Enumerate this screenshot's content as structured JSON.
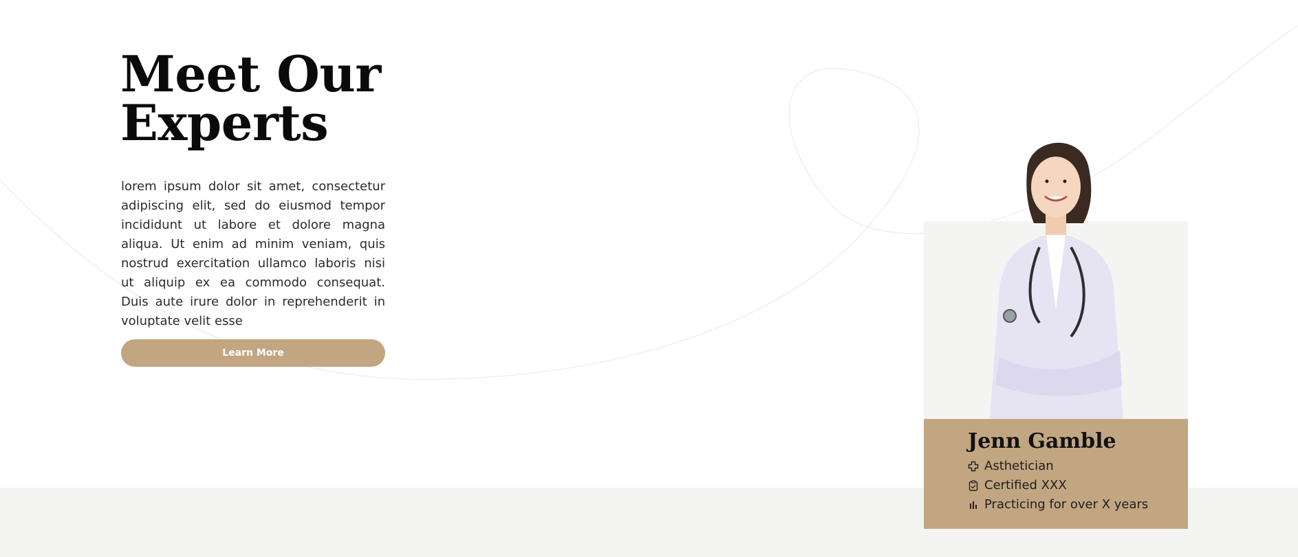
{
  "hero": {
    "heading_line1": "Meet Our",
    "heading_line2": "Experts",
    "body": "lorem ipsum dolor sit amet, consectetur adipiscing elit, sed do eiusmod tempor incididunt ut labore et dolore magna aliqua. Ut enim ad minim veniam, quis nostrud exercitation ullamco laboris nisi ut aliquip ex ea commodo consequat. Duis aute irure dolor in reprehenderit in voluptate velit esse",
    "button_label": "Learn More"
  },
  "expert": {
    "name": "Jenn Gamble",
    "details": [
      {
        "icon": "medical-cross-icon",
        "text": "Asthetician"
      },
      {
        "icon": "clipboard-icon",
        "text": "Certified XXX"
      },
      {
        "icon": "bar-chart-icon",
        "text": "Practicing for over X years"
      }
    ]
  },
  "colors": {
    "accent": "#c2a682",
    "card_bg": "#f4f4f2",
    "footer_band": "#f4f4f2",
    "heading": "#0a0a0a"
  }
}
